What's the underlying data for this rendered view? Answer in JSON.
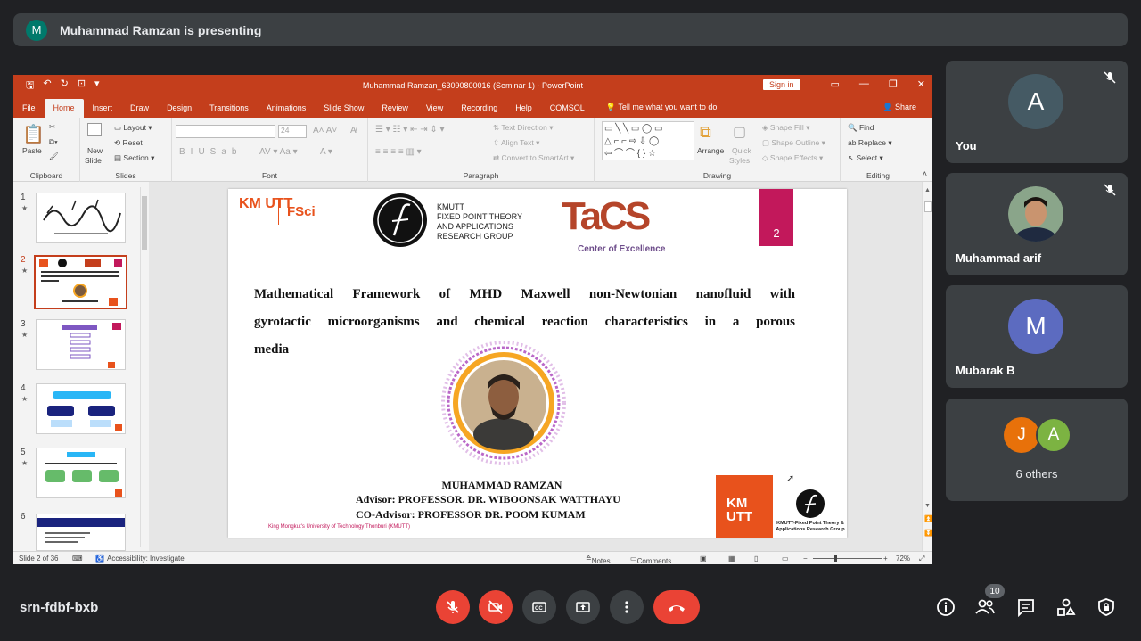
{
  "banner": {
    "avatar_letter": "M",
    "text": "Muhammad Ramzan is presenting"
  },
  "powerpoint": {
    "doc_title": "Muhammad Ramzan_63090800016 (Seminar 1)  -  PowerPoint",
    "sign_in": "Sign in",
    "tabs": [
      "File",
      "Home",
      "Insert",
      "Draw",
      "Design",
      "Transitions",
      "Animations",
      "Slide Show",
      "Review",
      "View",
      "Recording",
      "Help",
      "COMSOL"
    ],
    "tell_me": "Tell me what you want to do",
    "share": "Share",
    "ribbon": {
      "clipboard": {
        "paste": "Paste",
        "label": "Clipboard"
      },
      "slides": {
        "new_slide_1": "New",
        "new_slide_2": "Slide",
        "layout": "Layout",
        "reset": "Reset",
        "section": "Section",
        "label": "Slides"
      },
      "font": {
        "size": "24",
        "label": "Font"
      },
      "paragraph": {
        "text_direction": "Text Direction",
        "align_text": "Align Text",
        "convert_smartart": "Convert to SmartArt",
        "label": "Paragraph"
      },
      "drawing": {
        "arrange": "Arrange",
        "quick_styles_1": "Quick",
        "quick_styles_2": "Styles",
        "shape_fill": "Shape Fill",
        "shape_outline": "Shape Outline",
        "shape_effects": "Shape Effects",
        "label": "Drawing"
      },
      "editing": {
        "find": "Find",
        "replace": "Replace",
        "select": "Select",
        "label": "Editing"
      }
    },
    "thumbnails": [
      "1",
      "2",
      "3",
      "4",
      "5",
      "6"
    ],
    "slide": {
      "kmutt_logo": "KM UTT",
      "fsci_logo": "FSci",
      "group_line1": "KMUTT",
      "group_line2": "FIXED POINT THEORY",
      "group_line3": "AND APPLICATIONS",
      "group_line4": "RESEARCH GROUP",
      "tacs_logo": "TaCS",
      "tacs_sub": "Center of Excellence",
      "slide_number": "2",
      "title_line1": "Mathematical Framework of MHD Maxwell non-Newtonian nanofluid with",
      "title_line2": "gyrotactic microorganisms and chemical reaction characteristics in a porous",
      "title_line3": "media",
      "presenter": "MUHAMMAD RAMZAN",
      "advisor": "Advisor: PROFESSOR. DR. WIBOONSAK WATTHAYU",
      "co_advisor": "CO-Advisor: PROFESSOR DR. POOM KUMAM",
      "university": "King Mongkut's University of Technology Thonburi (KMUTT)",
      "footer_group_line1": "KMUTT-Fixed Point Theory &",
      "footer_group_line2": "Applications Research Group"
    },
    "status": {
      "slide_info": "Slide 2 of 36",
      "accessibility": "Accessibility: Investigate",
      "notes": "Notes",
      "comments": "Comments",
      "zoom": "72%"
    }
  },
  "participants": [
    {
      "name": "You",
      "letter": "A",
      "color": "#455a64"
    },
    {
      "name": "Muhammad arif"
    },
    {
      "name": "Mubarak B",
      "letter": "M",
      "color": "#5c6bc0"
    },
    {
      "name": "6 others",
      "letters": [
        "J",
        "A"
      ],
      "colors": [
        "#e8710a",
        "#7cb342"
      ]
    }
  ],
  "meeting": {
    "code": "srn-fdbf-bxb",
    "participant_count": "10"
  }
}
